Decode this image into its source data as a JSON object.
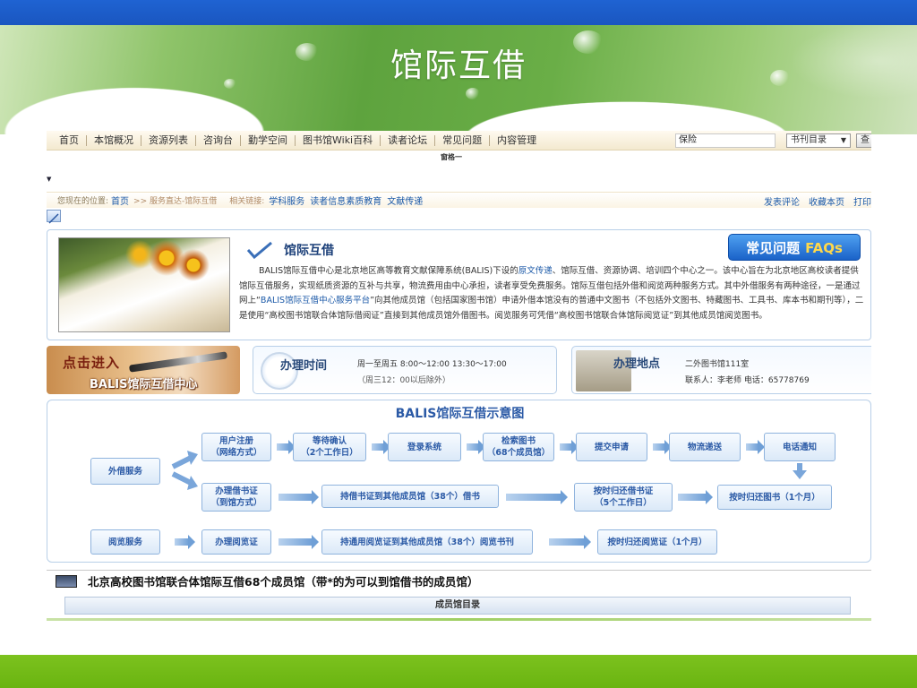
{
  "slide": {
    "title": "馆际互借"
  },
  "nav": {
    "items": [
      "首页",
      "本馆概况",
      "资源列表",
      "咨询台",
      "勤学空间",
      "图书馆Wiki百科",
      "读者论坛",
      "常见问题",
      "内容管理"
    ],
    "search_value": "保险",
    "select_value": "书刊目录",
    "go_label": "查",
    "window_label": "窗格一"
  },
  "breadcrumb": {
    "prefix": "您现在的位置:",
    "home": "首页",
    "path": ">> 服务直达-馆际互借",
    "related_label": "相关链接:",
    "related": [
      "学科服务",
      "读者信息素质教育",
      "文献传递"
    ],
    "right": [
      "发表评论",
      "收藏本页",
      "打印"
    ]
  },
  "intro": {
    "title": "馆际互借",
    "faq_cn": "常见问题",
    "faq_en": "FAQs",
    "text_before_link1": "BALIS馆际互借中心是北京地区高等教育文献保障系统(BALIS)下设的",
    "link1": "原文传递",
    "text_after_link1": "、馆际互借、资源协调、培训四个中心之一。该中心旨在为北京地区高校读者提供馆际互借服务，实现纸质资源的互补与共享，物流费用由中心承担，读者享受免费服务。馆际互借包括外借和阅览两种服务方式。其中外借服务有两种途径，一是通过网上“",
    "link2": "BALIS馆际互借中心服务平台",
    "text_after_link2": "”向其他成员馆（包括国家图书馆）申请外借本馆没有的普通中文图书（不包括外文图书、特藏图书、工具书、库本书和期刊等），二是使用“高校图书馆联合体馆际借阅证”直接到其他成员馆外借图书。阅览服务可凭借“高校图书馆联合体馆际阅览证”到其他成员馆阅览图书。"
  },
  "enter": {
    "line1": "点击进入",
    "line2": "BALIS馆际互借中心"
  },
  "hours": {
    "title": "办理时间",
    "line1": "周一至周五 8:00～12:00 13:30～17:00",
    "line2": "（周三12：00以后除外）"
  },
  "place": {
    "title": "办理地点",
    "line1": "二外图书馆111室",
    "line2": "联系人：李老师   电话：65778769"
  },
  "flow": {
    "title": "BALIS馆际互借示意图",
    "lend_service": "外借服务",
    "read_service": "阅览服务",
    "row1": [
      "用户注册\n（网络方式）",
      "等待确认\n（2个工作日）",
      "登录系统",
      "检索图书\n（68个成员馆）",
      "提交申请",
      "物流递送",
      "电话通知"
    ],
    "row2": [
      "办理借书证\n（到馆方式）",
      "持借书证到其他成员馆（38个）借书",
      "按时归还借书证\n（5个工作日）",
      "按时归还图书（1个月）"
    ],
    "row3": [
      "办理阅览证",
      "持通用阅览证到其他成员馆（38个）阅览书刊",
      "按时归还阅览证（1个月）"
    ]
  },
  "members": {
    "title": "北京高校图书馆联合体馆际互借68个成员馆（带*的为可以到馆借书的成员馆）",
    "catalog_label": "成员馆目录"
  }
}
